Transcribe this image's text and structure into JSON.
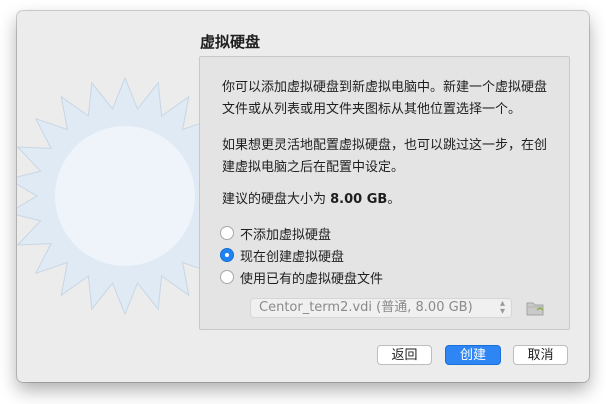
{
  "dialog": {
    "title": "虚拟硬盘",
    "intro": "你可以添加虚拟硬盘到新虚拟电脑中。新建一个虚拟硬盘文件或从列表或用文件夹图标从其他位置选择一个。",
    "skip_hint": "如果想更灵活地配置虚拟硬盘，也可以跳过这一步，在创建虚拟电脑之后在配置中设定。",
    "recommend_prefix": "建议的硬盘大小为 ",
    "recommend_size": "8.00 GB",
    "recommend_suffix": "。"
  },
  "options": [
    {
      "label": "不添加虚拟硬盘",
      "checked": false
    },
    {
      "label": "现在创建虚拟硬盘",
      "checked": true
    },
    {
      "label": "使用已有的虚拟硬盘文件",
      "checked": false
    }
  ],
  "disk_select": {
    "value": "Centor_term2.vdi (普通, 8.00 GB)",
    "disabled": true
  },
  "buttons": {
    "back": "返回",
    "create": "创建",
    "cancel": "取消"
  },
  "icons": {
    "illustration": "virtualbox-starburst",
    "folder": "folder-icon",
    "select_chevron": "chevron-updown-icon"
  },
  "colors": {
    "accent": "#2e86f5",
    "starburst": "#dfeaf4",
    "window_bg": "#ececec"
  }
}
